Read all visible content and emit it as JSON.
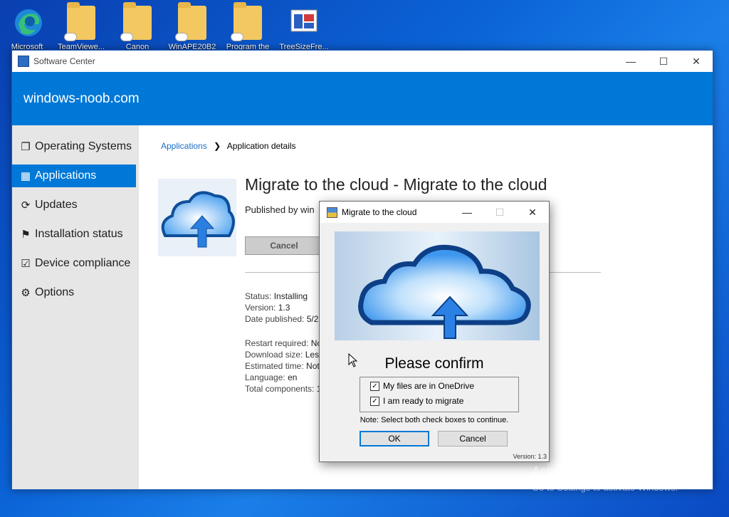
{
  "desktop": {
    "icons": [
      {
        "label": "Microsoft",
        "icon": "edge-icon"
      },
      {
        "label": "TeamViewe...",
        "icon": "folder-icon"
      },
      {
        "label": "Canon",
        "icon": "folder-icon"
      },
      {
        "label": "WinAPE20B2",
        "icon": "folder-icon"
      },
      {
        "label": "Program the",
        "icon": "folder-icon"
      },
      {
        "label": "TreeSizeFre...",
        "icon": "treesize-icon"
      }
    ],
    "watermark_title": "Activate Windows",
    "watermark_sub": "Go to Settings to activate Windows."
  },
  "window": {
    "title": "Software Center",
    "banner": "windows-noob.com",
    "controls": {
      "minimize": "—",
      "maximize": "☐",
      "close": "✕"
    }
  },
  "sidebar": {
    "items": [
      {
        "label": "Operating Systems",
        "icon": "operating-systems-icon",
        "glyph": "❐",
        "active": false
      },
      {
        "label": "Applications",
        "icon": "applications-icon",
        "glyph": "▦",
        "active": true
      },
      {
        "label": "Updates",
        "icon": "updates-icon",
        "glyph": "⟳",
        "active": false
      },
      {
        "label": "Installation status",
        "icon": "flag-icon",
        "glyph": "⚑",
        "active": false
      },
      {
        "label": "Device compliance",
        "icon": "compliance-icon",
        "glyph": "☑",
        "active": false
      },
      {
        "label": "Options",
        "icon": "gear-icon",
        "glyph": "⚙",
        "active": false
      }
    ]
  },
  "breadcrumb": {
    "link": "Applications",
    "separator": "❯",
    "current": "Application details"
  },
  "app": {
    "title": "Migrate to the cloud - Migrate to the cloud",
    "published_by": "Published by win",
    "cancel_label": "Cancel",
    "details": [
      {
        "label": "Status: ",
        "value": "Installing"
      },
      {
        "label": "Version: ",
        "value": "1.3"
      },
      {
        "label": "Date published: ",
        "value": "5/2"
      }
    ],
    "details2": [
      {
        "label": "Restart required: ",
        "value": "No"
      },
      {
        "label": "Download size: ",
        "value": "Less"
      },
      {
        "label": "Estimated time: ",
        "value": "Not"
      },
      {
        "label": "Language: ",
        "value": "en"
      },
      {
        "label": "Total components: ",
        "value": "1"
      }
    ]
  },
  "dialog": {
    "title": "Migrate to the cloud",
    "heading": "Please confirm",
    "checkbox1": "My files are in OneDrive",
    "checkbox1_checked": true,
    "checkbox2": "I am ready to migrate",
    "checkbox2_checked": true,
    "note": "Note: Select both check boxes to continue.",
    "ok_label": "OK",
    "cancel_label": "Cancel",
    "version": "Version: 1.3"
  },
  "colors": {
    "accent": "#0078d7",
    "sidebar_bg": "#e6e6e6"
  }
}
